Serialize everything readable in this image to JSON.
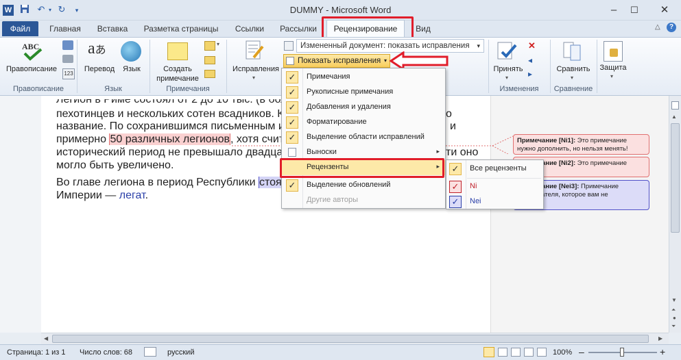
{
  "window": {
    "title": "DUMMY  -  Microsoft Word",
    "app_icon": "W",
    "minimize": "–",
    "maximize": "☐",
    "close": "✕"
  },
  "tabs": {
    "file": "Файл",
    "home": "Главная",
    "insert": "Вставка",
    "layout": "Разметка страницы",
    "refs": "Ссылки",
    "mailings": "Рассылки",
    "review": "Рецензирование",
    "view": "Вид"
  },
  "ribbon": {
    "spelling": "Правописание",
    "spelling_group": "Правописание",
    "translate": "Перевод",
    "language": "Язык",
    "language_group": "Язык",
    "new_comment": "Создать\nпримечание",
    "comments_group": "Примечания",
    "track_changes": "Исправления",
    "display_mode": "Измененный документ: показать исправления",
    "show_markup": "Показать исправления",
    "accept": "Принять",
    "changes_group": "Изменения",
    "compare": "Сравнить",
    "compare_group": "Сравнение",
    "protect": "Защита"
  },
  "document": {
    "line1": "Легион в Риме состоял от 2 до 10 тыс. (в бол",
    "line2": "пехотинцев и нескольких сотен всадников. К",
    "line3": "название. По сохранившимся письменным и",
    "line4a": "примерно ",
    "line4b": "50 различных легионов",
    "line4c": ", хотя счит",
    "line5": "исторический период не превышало двадца",
    "line5b": "ти оно",
    "line6": "могло быть увеличено.",
    "line7a": "Во главе легиона в период Республики ",
    "line7b": "стоя",
    "line8a": "Империи — ",
    "line8b": "легат",
    "line8c": ".",
    "line2end": "о",
    "line3end": "и"
  },
  "comments": [
    {
      "title": "Примечание [Ni1]:",
      "text": "Это примечание нужно дополнить, но нельзя менять!"
    },
    {
      "title": "Примечание [Ni2]:",
      "text": "Это примечание"
    },
    {
      "title": "Примечание [Nei3]:",
      "text": "Примечание"
    }
  ],
  "comments_partial": {
    "c2_line1": "чание [Ni2]: Это примечание",
    "c2_line2": "ечание.",
    "c3_line1": "чание [Nei3]: Примечание",
    "c3_line2": "пользователя, которое вам не",
    "c3_line3": "нравится"
  },
  "menu": {
    "items": [
      {
        "label": "Примечания",
        "checked": "✓"
      },
      {
        "label": "Рукописные примечания",
        "checked": "✓"
      },
      {
        "label": "Добавления и удаления",
        "checked": "✓"
      },
      {
        "label": "Форматирование",
        "checked": "✓"
      },
      {
        "label": "Выделение области исправлений",
        "checked": "✓"
      },
      {
        "label": "Выноски",
        "checked": "",
        "arrow": "▸"
      },
      {
        "label": "Рецензенты",
        "checked": "",
        "arrow": "▸"
      },
      {
        "label": "Выделение обновлений",
        "checked": "✓"
      },
      {
        "label": "Другие авторы",
        "checked": ""
      }
    ]
  },
  "submenu": {
    "items": [
      {
        "label": "Все рецензенты",
        "checked": "✓",
        "color": "#222222"
      },
      {
        "label": "Ni",
        "checked": "✓",
        "color": "#c0202a"
      },
      {
        "label": "Nei",
        "checked": "✓",
        "color": "#2a3fa8"
      }
    ]
  },
  "status": {
    "page": "Страница: 1 из 1",
    "words": "Число слов: 68",
    "language": "русский",
    "zoom": "100%",
    "zoom_minus": "–",
    "zoom_plus": "+"
  },
  "colors": {
    "accent": "#2b5797",
    "highlight_red": "#e11d2a",
    "ni_comment_bg": "#fbe0e0",
    "ni_comment_border": "#e07070",
    "nei_comment_bg": "#dcdcf8",
    "nei_comment_border": "#5050c8"
  }
}
